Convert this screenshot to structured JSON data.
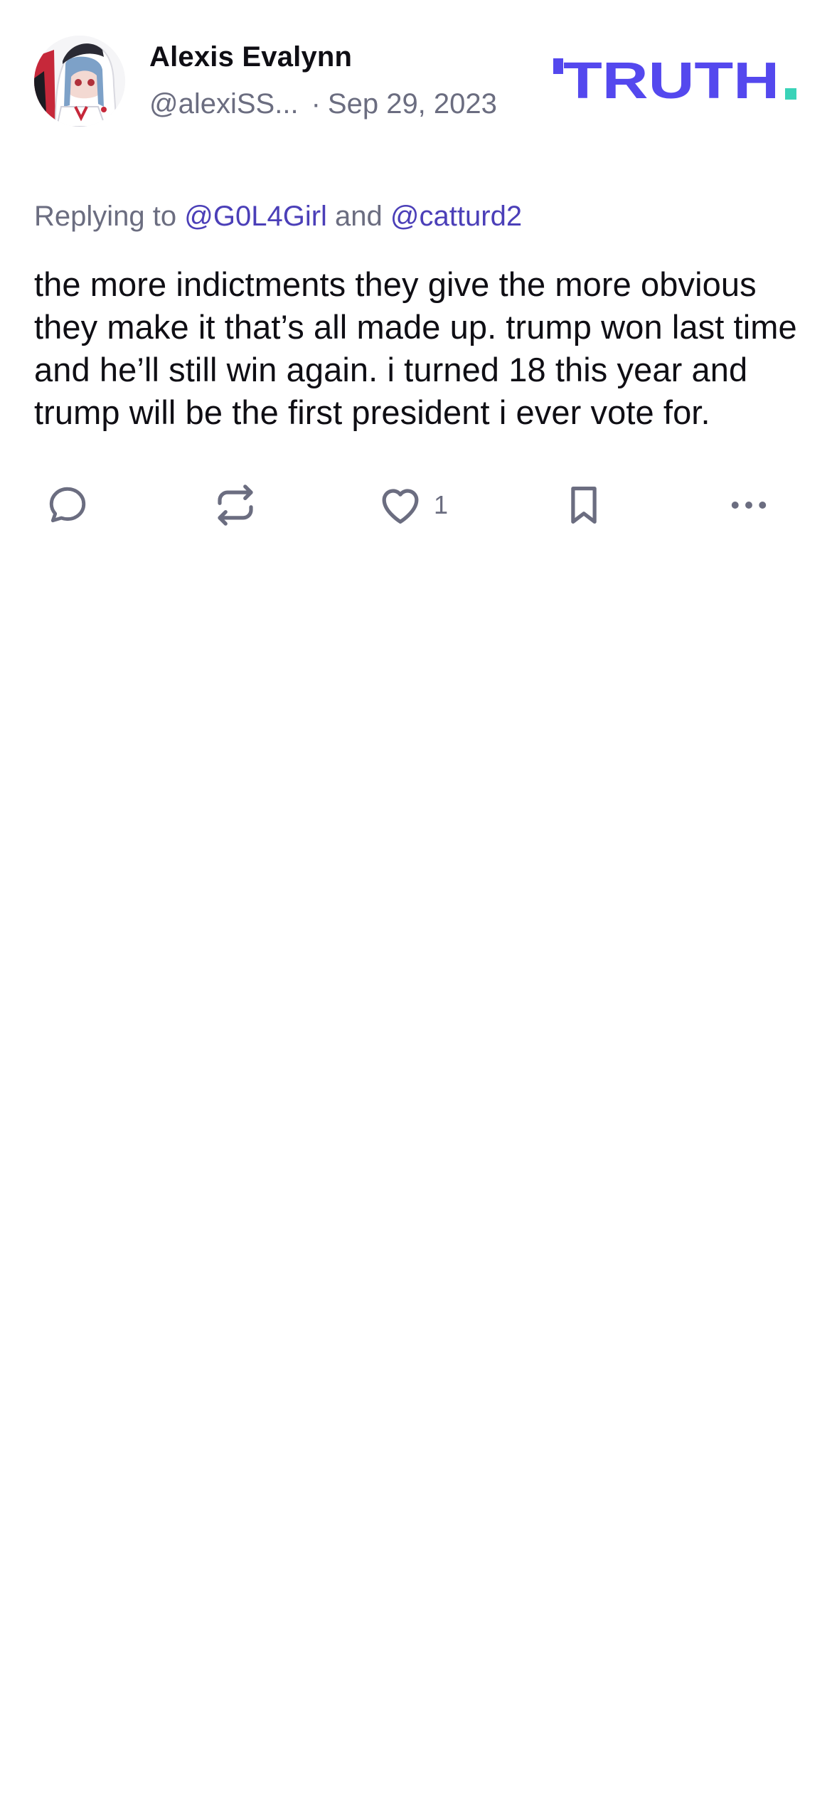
{
  "post": {
    "author": {
      "display_name": "Alexis Evalynn",
      "handle": "@alexiSS...",
      "avatar_icon": "anime-avatar-icon"
    },
    "separator": "·",
    "date": "Sep 29, 2023",
    "brand": {
      "logo_text": "TRUTH",
      "primary_color": "#5448ee",
      "accent_color": "#3ad3b8"
    },
    "reply": {
      "prefix": "Replying to",
      "mention_1": "@G0L4Girl",
      "conjunction": "and",
      "mention_2": "@catturd2"
    },
    "content": "the more indictments they give the more obvious they make it that’s all made up. trump won last time and he’ll still win again. i turned 18 this year and trump will be the first president i ever vote for.",
    "actions": {
      "reply_icon": "speech-bubble-icon",
      "retruth_icon": "repost-icon",
      "like_icon": "heart-icon",
      "like_count": "1",
      "bookmark_icon": "bookmark-icon",
      "more_icon": "more-dots-icon"
    }
  }
}
